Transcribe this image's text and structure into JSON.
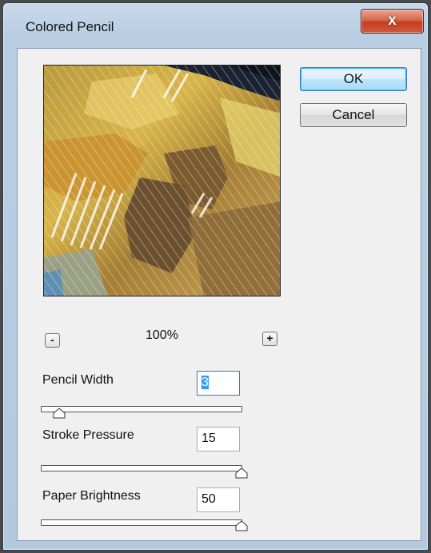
{
  "window": {
    "title": "Colored Pencil",
    "close_glyph": "x"
  },
  "buttons": {
    "ok": "OK",
    "cancel": "Cancel"
  },
  "zoom": {
    "minus": "-",
    "plus": "+",
    "level": "100%"
  },
  "params": [
    {
      "label": "Pencil Width",
      "value": "3",
      "fraction": 0.08
    },
    {
      "label": "Stroke Pressure",
      "value": "15",
      "fraction": 1.0
    },
    {
      "label": "Paper Brightness",
      "value": "50",
      "fraction": 1.0
    }
  ]
}
